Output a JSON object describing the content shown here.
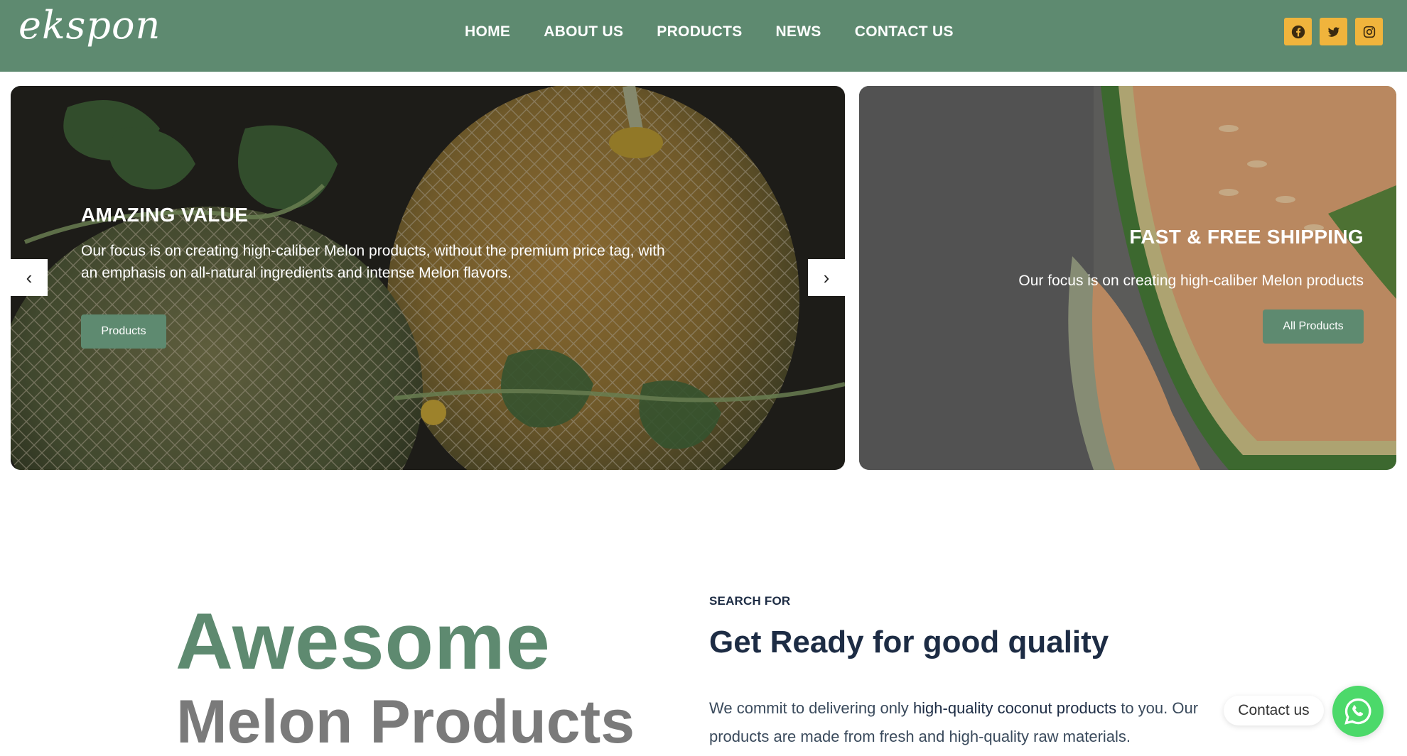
{
  "brand": {
    "logo_text": "ekspon"
  },
  "nav": {
    "items": [
      "HOME",
      "ABOUT US",
      "PRODUCTS",
      "NEWS",
      "CONTACT US"
    ]
  },
  "social": {
    "icons": [
      "facebook-icon",
      "twitter-icon",
      "instagram-icon"
    ],
    "accent": "#f0b43c"
  },
  "slider": {
    "title": "AMAZING VALUE",
    "text_line1": "Our focus is on creating high-caliber Melon products, without the premium price tag, with",
    "text_line2": "an emphasis on all-natural ingredients and intense Melon flavors.",
    "button": "Products",
    "prev_icon": "‹",
    "next_icon": "›"
  },
  "promo": {
    "title": "FAST & FREE SHIPPING",
    "text": "Our focus is on creating high-caliber Melon products",
    "button": "All Products"
  },
  "about": {
    "heading1": "Awesome",
    "heading2": "Melon Products",
    "eyebrow": "SEARCH FOR",
    "title": "Get Ready for good quality",
    "p_before": "We commit to delivering only ",
    "p_highlight": "high-quality coconut products",
    "p_after": " to you. Our products are made from fresh and high-quality raw materials."
  },
  "contact_widget": {
    "label": "Contact us"
  },
  "colors": {
    "brand_green": "#5e8a70",
    "navy": "#1d2c44",
    "whatsapp_green": "#4cd96a",
    "gray_heading": "#7a7a7a"
  }
}
